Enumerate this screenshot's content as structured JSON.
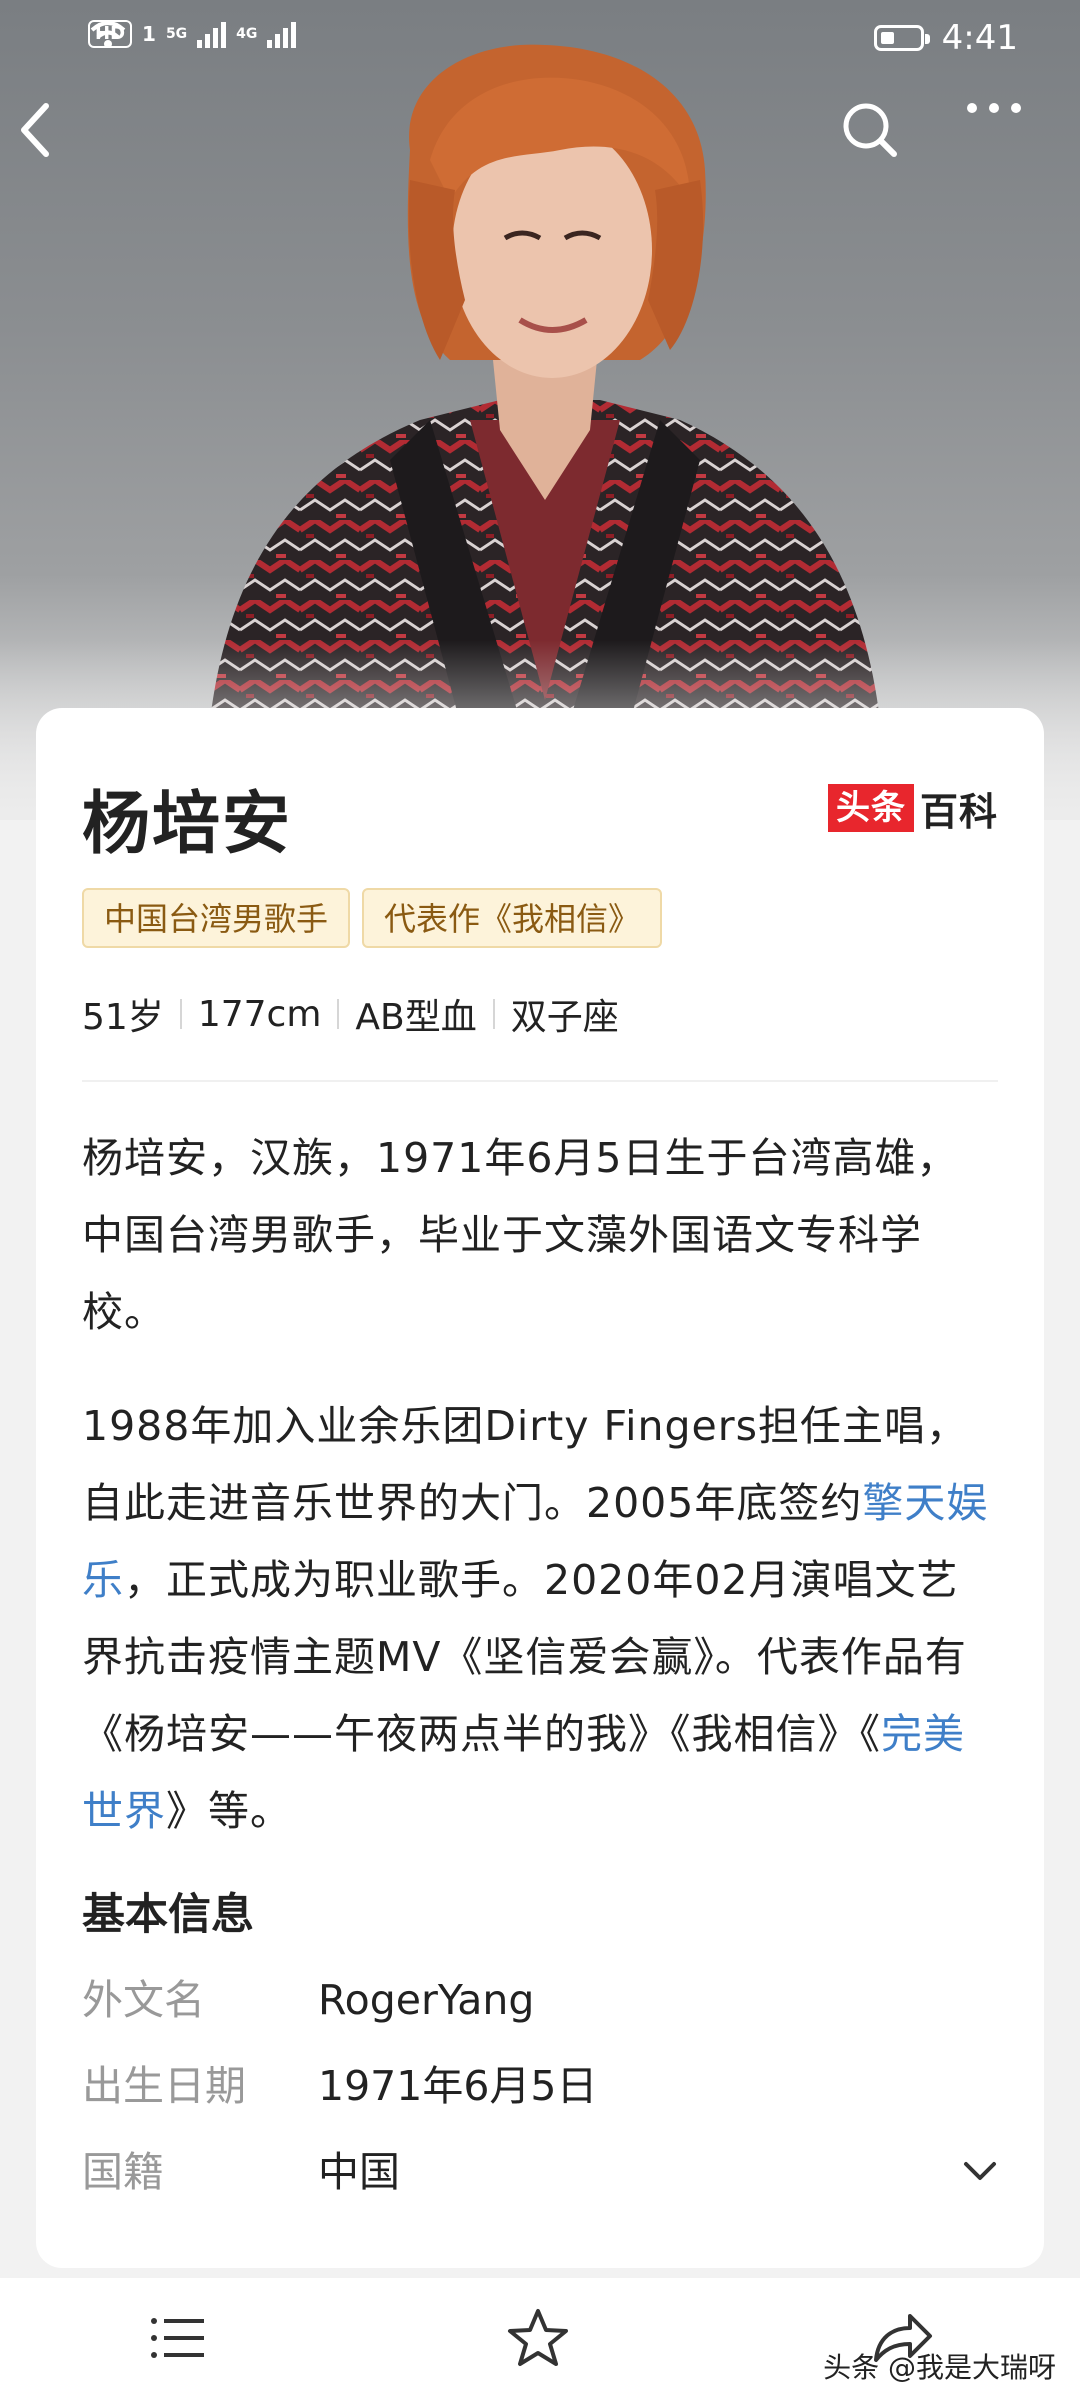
{
  "status_bar": {
    "hd": "HD",
    "sim": "1",
    "net1": "5G",
    "net2": "4G",
    "battery_level": 0.35,
    "time": "4:41"
  },
  "nav": {
    "back_icon": "chevron-left-icon",
    "search_icon": "search-icon",
    "more_icon": "more-horizontal-icon"
  },
  "card": {
    "title": "杨培安",
    "brand": {
      "part1": "头条",
      "part2": "百科",
      "color": "#e8262d"
    },
    "tags": [
      "中国台湾男歌手",
      "代表作《我相信》"
    ],
    "stats": [
      "51岁",
      "177cm",
      "AB型血",
      "双子座"
    ],
    "intro": "杨培安，汉族，1971年6月5日生于台湾高雄，中国台湾男歌手，毕业于文藻外国语文专科学校。",
    "career": {
      "t1": "1988年加入业余乐团Dirty Fingers担任主唱，自此走进音乐世界的大门。2005年底签约",
      "link1": "擎天娱乐",
      "t2": "，正式成为职业歌手。2020年02月演唱文艺界抗击疫情主题MV《坚信爱会赢》。代表作品有《杨培安——午夜两点半的我》《我相信》《",
      "link2": "完美世界",
      "t3": "》等。"
    },
    "basic_info": {
      "title": "基本信息",
      "rows": [
        {
          "label": "外文名",
          "value": "RogerYang"
        },
        {
          "label": "出生日期",
          "value": "1971年6月5日"
        },
        {
          "label": "国籍",
          "value": "中国"
        }
      ],
      "expand_icon": "chevron-down-icon"
    }
  },
  "toolbar": {
    "menu_icon": "list-icon",
    "favorite_icon": "star-icon",
    "share_icon": "share-icon"
  },
  "watermark": "头条 @我是大瑞呀"
}
